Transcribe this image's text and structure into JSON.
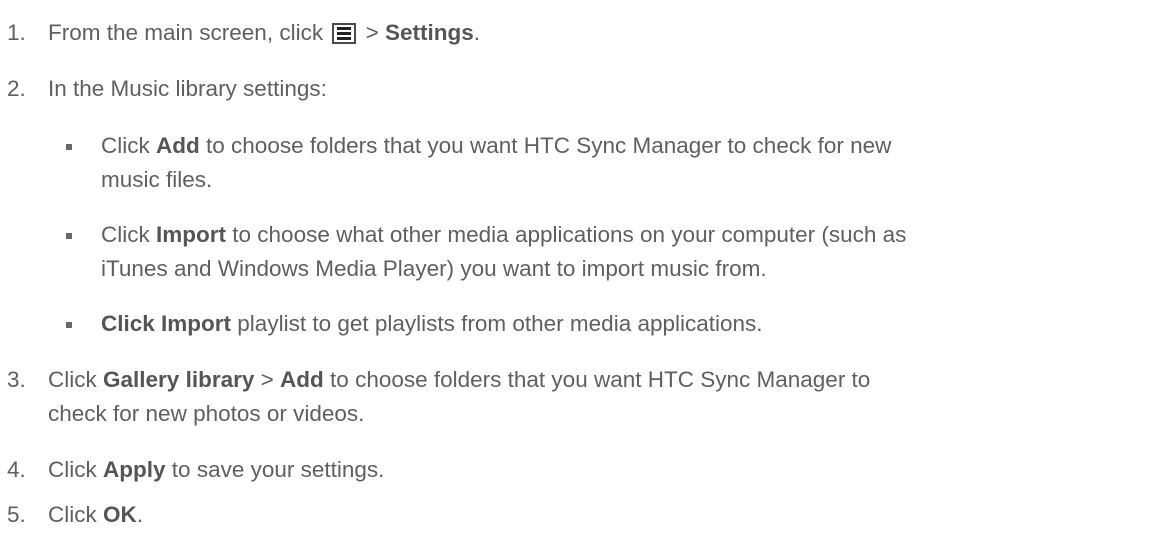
{
  "steps": [
    {
      "num": "1.",
      "pre": "From the main screen, click",
      "icon": "hamburger-menu-icon",
      "sep": ">",
      "bold": "Settings",
      "post": "."
    },
    {
      "num": "2.",
      "text": "In the Music library settings:",
      "bullets": [
        {
          "pre": "Click",
          "bold": "Add",
          "line1": "to choose folders that you want HTC Sync Manager to check for new",
          "line2": "music files."
        },
        {
          "pre": "Click",
          "bold": "Import",
          "line1": "to choose what other media applications on your computer (such as",
          "line2": "iTunes and Windows Media Player) you want to import music from."
        },
        {
          "bold": "Click Import",
          "line1": "playlist to get playlists from other media applications."
        }
      ]
    },
    {
      "num": "3.",
      "pre": "Click",
      "bold1": "Gallery library",
      "sep": ">",
      "bold2": "Add",
      "line1": "to choose folders that you want HTC Sync Manager to",
      "line2": "check for new photos or videos."
    },
    {
      "num": "4.",
      "pre": "Click",
      "bold": "Apply",
      "post": "to save your settings."
    },
    {
      "num": "5.",
      "pre": "Click",
      "bold": "OK",
      "post": "."
    }
  ]
}
